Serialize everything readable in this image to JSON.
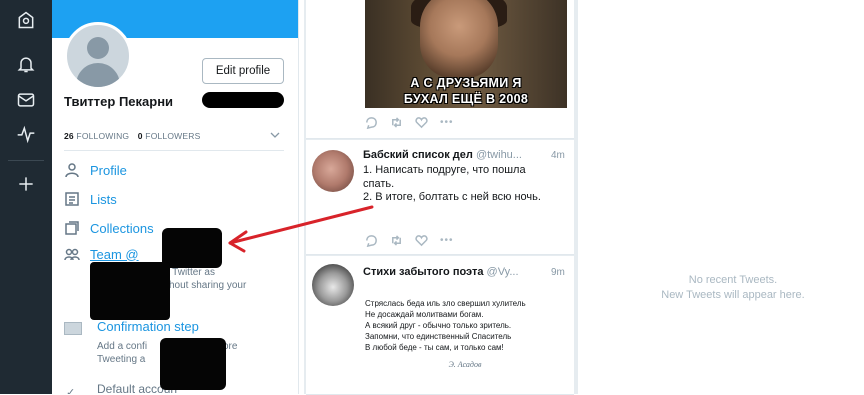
{
  "rail": {
    "icons": [
      "home-icon",
      "notifications-bell-icon",
      "messages-icon",
      "activity-icon",
      "add-column-icon"
    ]
  },
  "profile": {
    "edit_label": "Edit profile",
    "name": "Твиттер Пекарни",
    "following_count": "26",
    "following_label": "FOLLOWING",
    "followers_count": "0",
    "followers_label": "FOLLOWERS"
  },
  "menu": {
    "profile": "Profile",
    "lists": "Lists",
    "collections": "Collections",
    "team": "Team @",
    "team_desc_l1": "e Twitter as",
    "team_desc_l2": "ithout sharing your",
    "confirmation": "Confirmation step",
    "confirmation_desc_l1": "Add a confi",
    "confirmation_desc_l1b": "before",
    "confirmation_desc_l2": "Tweeting a",
    "confirmation_desc_l2b": "t",
    "default_account": "Default accoun"
  },
  "feed": {
    "meme_line1": "А С ДРУЗЬЯМИ Я",
    "meme_line2": "БУХАЛ ЕЩЁ В 2008",
    "tweet1": {
      "name": "Бабский список дел",
      "handle": "@twihu...",
      "time": "4m",
      "text": "1. Написать подруге, что пошла спать.",
      "text2": "2. В итоге, болтать с ней всю ночь."
    },
    "tweet2": {
      "name": "Стихи забытого поэта",
      "handle": "@Vy...",
      "time": "9m",
      "poem": [
        "Стряслась беда иль зло свершил хулитель",
        "Не досаждай молитвами богам.",
        "А всякий друг - обычно только зритель.",
        "Запомни, что единственный Спаситель",
        "В любой беде - ты сам, и только сам!"
      ],
      "signature": "Э. Асадов"
    }
  },
  "empty_column": {
    "line1": "No recent Tweets.",
    "line2": "New Tweets will appear here."
  },
  "colors": {
    "rail": "#1f2a33",
    "accent": "#1da1f2",
    "link": "#1b95e0",
    "arrow": "#d8232a"
  }
}
